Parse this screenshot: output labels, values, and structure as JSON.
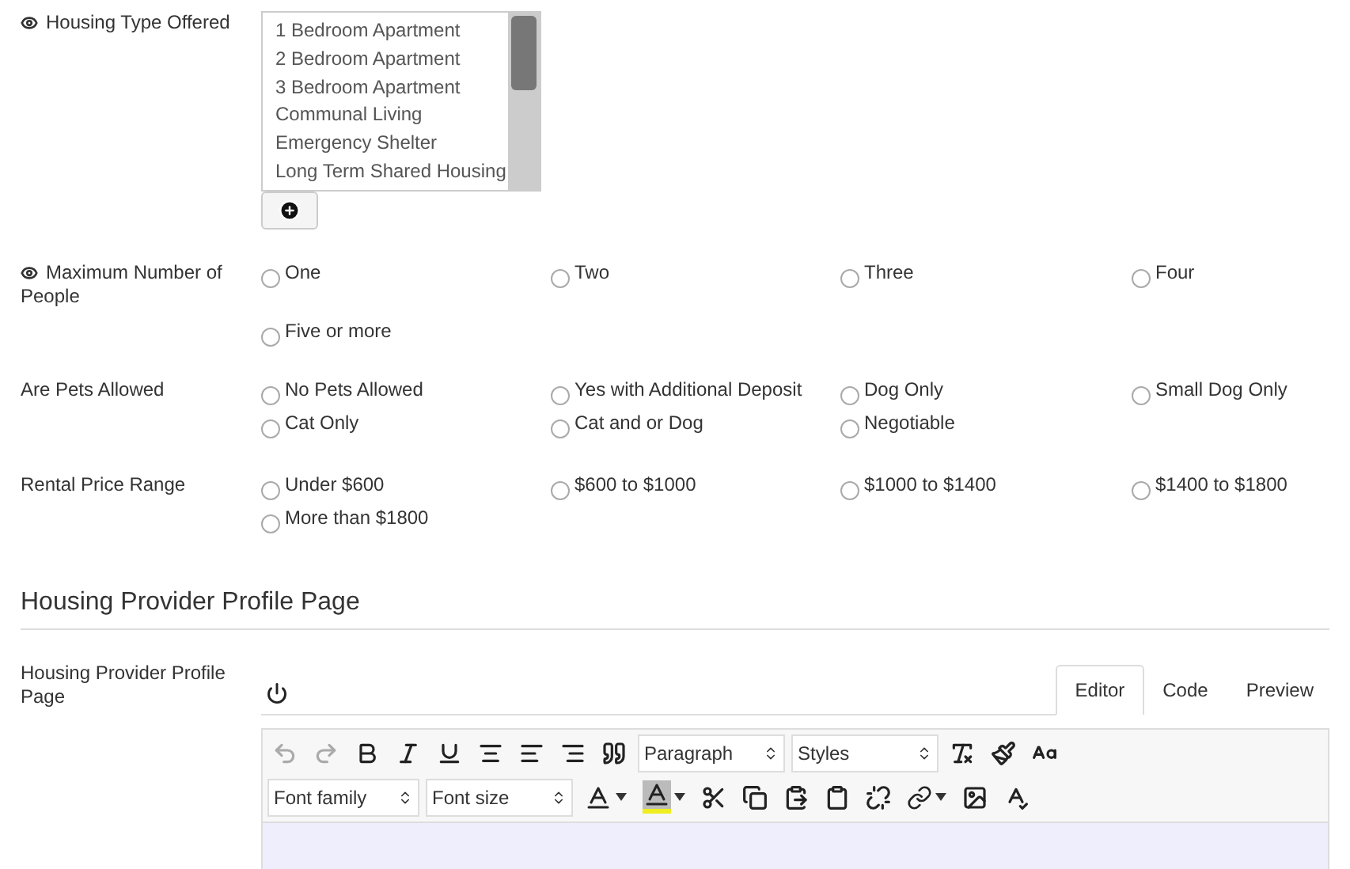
{
  "housing_type": {
    "label": "Housing Type Offered",
    "visible_icon": true,
    "options": [
      {
        "label": "1 Bedroom Apartment",
        "selected": false
      },
      {
        "label": "2 Bedroom Apartment",
        "selected": false
      },
      {
        "label": "3 Bedroom Apartment",
        "selected": false
      },
      {
        "label": "Communal Living",
        "selected": false
      },
      {
        "label": "Emergency Shelter",
        "selected": false
      },
      {
        "label": "Long Term Shared Housing",
        "selected": false
      }
    ]
  },
  "radio_groups": [
    {
      "label": "Maximum Number of People",
      "visible_icon": true,
      "options": [
        {
          "label": "One",
          "selected": false
        },
        {
          "label": "Two",
          "selected": false
        },
        {
          "label": "Three",
          "selected": false
        },
        {
          "label": "Four",
          "selected": false
        },
        {
          "label": "Five or more",
          "selected": false
        }
      ]
    },
    {
      "label": "Are Pets Allowed",
      "visible_icon": false,
      "options": [
        {
          "label": "No Pets Allowed",
          "selected": false
        },
        {
          "label": "Yes with Additional Deposit",
          "selected": false
        },
        {
          "label": "Dog Only",
          "selected": false
        },
        {
          "label": "Small Dog Only",
          "selected": false
        },
        {
          "label": "Cat Only",
          "selected": false
        },
        {
          "label": "Cat and or Dog",
          "selected": false
        },
        {
          "label": "Negotiable",
          "selected": false
        }
      ]
    },
    {
      "label": "Rental Price Range",
      "visible_icon": false,
      "options": [
        {
          "label": "Under $600",
          "selected": false
        },
        {
          "label": "$600 to $1000",
          "selected": false
        },
        {
          "label": "$1000 to $1400",
          "selected": false
        },
        {
          "label": "$1400 to $1800",
          "selected": false
        },
        {
          "label": "More than $1800",
          "selected": false
        }
      ]
    }
  ],
  "section_title": "Housing Provider Profile Page",
  "editor_field": {
    "label": "Housing Provider Profile Page",
    "tabs": [
      {
        "label": "Editor",
        "selected": true
      },
      {
        "label": "Code",
        "selected": false
      },
      {
        "label": "Preview",
        "selected": false
      }
    ],
    "selects": [
      "Paragraph",
      "Styles",
      "Font family",
      "Font size"
    ]
  }
}
